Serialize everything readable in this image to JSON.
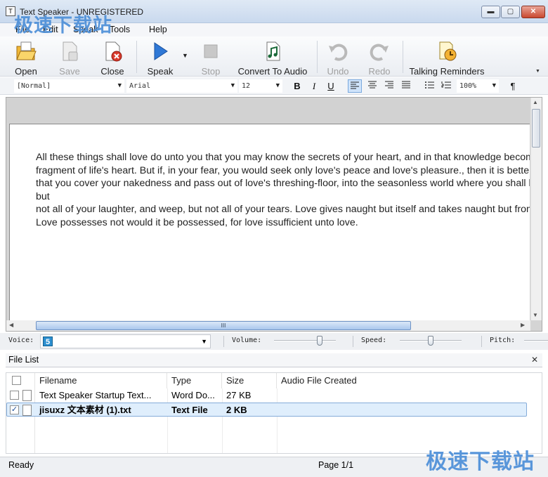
{
  "window": {
    "title": "Text Speaker - UNREGISTERED",
    "min": "▬",
    "max": "▢",
    "close": "✕"
  },
  "menu": [
    "File",
    "Edit",
    "Speak",
    "Tools",
    "Help"
  ],
  "toolbar": {
    "open": "Open",
    "save": "Save",
    "close": "Close",
    "speak": "Speak",
    "stop": "Stop",
    "convert": "Convert To Audio",
    "undo": "Undo",
    "redo": "Redo",
    "reminders": "Talking Reminders"
  },
  "format": {
    "style": "[Normal]",
    "font": "Arial",
    "size": "12",
    "zoom": "100%",
    "bold": "B",
    "italic": "I",
    "underline": "U",
    "pilcrow": "¶"
  },
  "document": {
    "text": "All these things shall love do unto you that you may know the secrets of your heart, and in that knowledge become a\nfragment of life's heart. But if, in your fear, you would seek only love's peace and love's pleasure., then it is better for you\nthat you cover your nakedness and pass out of love's threshing-floor, into the seasonless world where you shall laugh, but\nnot all of your laughter, and weep, but not all of your tears. Love gives naught but itself and takes naught but from itself.\nLove possesses not would it be possessed, for love issufficient unto love."
  },
  "scroll": {
    "grip": "III"
  },
  "voice": {
    "label": "Voice:",
    "value": "5",
    "volume_label": "Volume:",
    "speed_label": "Speed:",
    "pitch_label": "Pitch:",
    "volume": 0.76,
    "speed": 0.5
  },
  "file_list": {
    "title": "File List",
    "close": "✕",
    "columns": [
      "Filename",
      "Type",
      "Size",
      "Audio File Created"
    ],
    "rows": [
      {
        "checked": false,
        "filename": "Text Speaker Startup Text...",
        "type": "Word Do...",
        "size": "27 KB",
        "audio": ""
      },
      {
        "checked": true,
        "filename": "jisuxz 文本素材 (1).txt",
        "type": "Text File",
        "size": "2 KB",
        "audio": ""
      }
    ]
  },
  "status": {
    "left": "Ready",
    "page": "Page 1/1"
  },
  "watermarks": {
    "top": "极速下载站",
    "bottom": "极速下载站"
  }
}
